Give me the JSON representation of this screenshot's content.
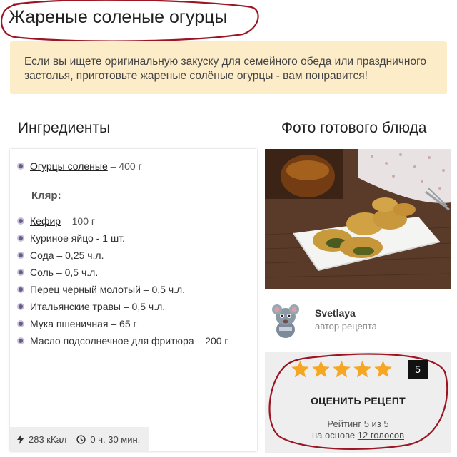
{
  "recipe": {
    "title": "Жареные соленые огурцы",
    "intro": "Если вы ищете оригинальную закуску для семейного обеда или праздничного застолья, приготовьте жареные солёные огурцы - вам понравится!"
  },
  "ingredients": {
    "heading": "Ингредиенты",
    "main": [
      {
        "name": "Огурцы соленые",
        "amount": "– 400 г",
        "link": true
      }
    ],
    "batter_heading": "Кляр:",
    "batter": [
      {
        "name": "Кефир",
        "amount": "– 100 г",
        "link": true
      },
      {
        "name": "Куриное яйцо - 1 шт.",
        "amount": "",
        "link": false
      },
      {
        "name": "Сода – 0,25 ч.л.",
        "amount": "",
        "link": false
      },
      {
        "name": "Соль – 0,5 ч.л.",
        "amount": "",
        "link": false
      },
      {
        "name": "Перец черный молотый – 0,5 ч.л.",
        "amount": "",
        "link": false
      },
      {
        "name": "Итальянские травы – 0,5 ч.л.",
        "amount": "",
        "link": false
      },
      {
        "name": "Мука пшеничная – 65 г",
        "amount": "",
        "link": false
      },
      {
        "name": "Масло подсолнечное для фритюра – 200 г",
        "amount": "",
        "link": false
      }
    ]
  },
  "stats": {
    "calories": "283 кКал",
    "time": "0 ч. 30 мин."
  },
  "photo": {
    "heading": "Фото готового блюда"
  },
  "author": {
    "name": "Svetlaya",
    "role": "автор рецепта"
  },
  "rating": {
    "stars_filled": 5,
    "stars_total": 5,
    "count_badge": "5",
    "button_label": "ОЦЕНИТЬ РЕЦЕПТ",
    "summary": "Рейтинг 5 из 5",
    "based_on": "на основе",
    "votes_link": "12 голосов"
  },
  "colors": {
    "intro_bg": "#fdecc8",
    "star": "#f5a623",
    "annotation": "#9b1522",
    "badge_bg": "#111111"
  },
  "icons": [
    "lightning-icon",
    "clock-icon",
    "star-icon",
    "bullet-icon"
  ]
}
